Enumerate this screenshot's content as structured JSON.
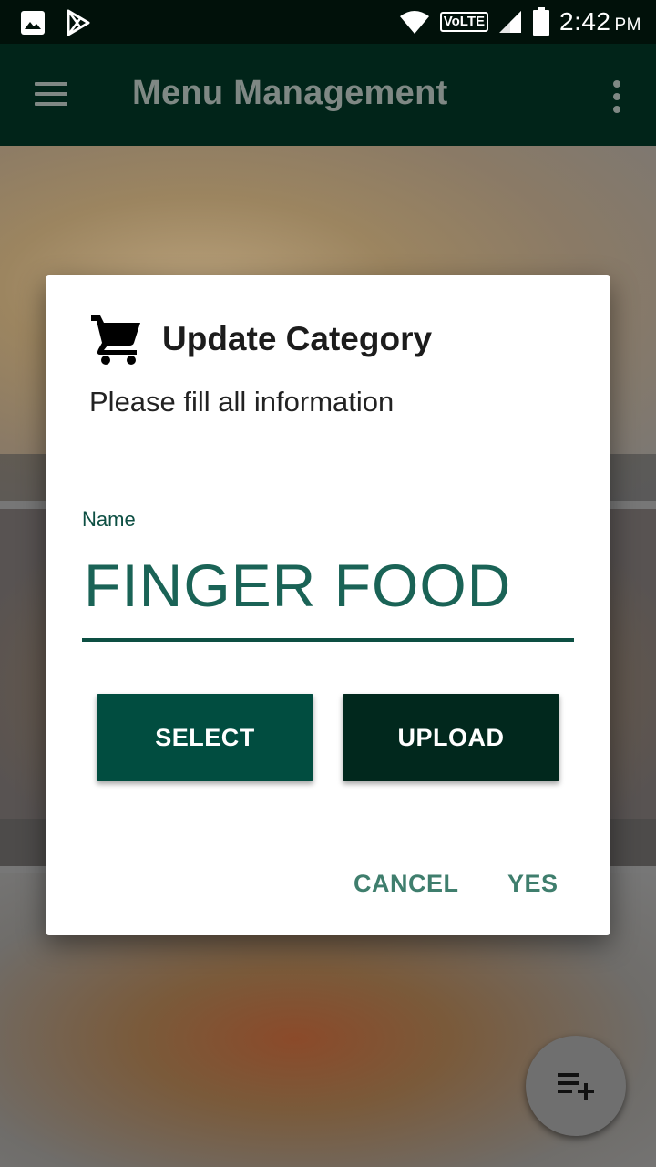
{
  "status_bar": {
    "time": "2:42",
    "ampm": "PM",
    "network_label": "VoLTE",
    "icons": [
      "image-icon",
      "play-store-icon",
      "wifi-icon",
      "signal-icon",
      "battery-icon"
    ]
  },
  "app_bar": {
    "title": "Menu Management",
    "menu_icon": "hamburger-icon",
    "overflow_icon": "more-vert-icon"
  },
  "dialog": {
    "icon": "shopping-cart-icon",
    "title": "Update Category",
    "message": "Please fill all information",
    "field_label": "Name",
    "field_value": "FINGER FOOD",
    "select_label": "SELECT",
    "upload_label": "UPLOAD",
    "cancel_label": "CANCEL",
    "yes_label": "YES"
  },
  "fab": {
    "icon": "playlist-add-icon"
  },
  "colors": {
    "app_bar": "#012419",
    "status_bar": "#01110a",
    "accent": "#0d4f43",
    "select_button": "#014d40",
    "upload_button": "#01281d",
    "text_button": "#3f7e6d"
  }
}
